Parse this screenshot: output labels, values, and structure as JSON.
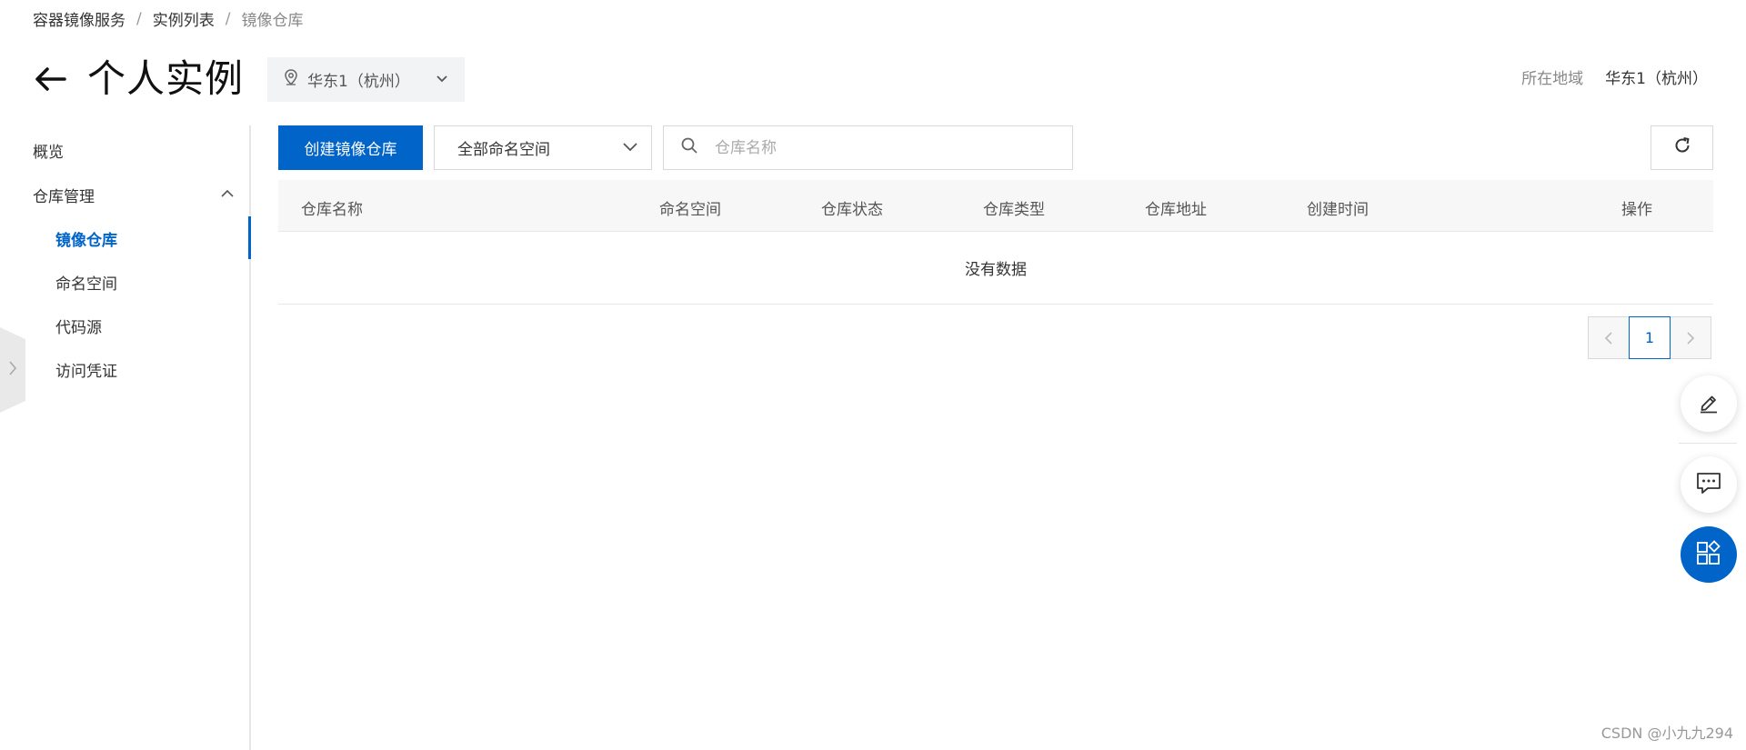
{
  "breadcrumb": {
    "items": [
      "容器镜像服务",
      "实例列表",
      "镜像仓库"
    ],
    "separator": "/"
  },
  "header": {
    "title": "个人实例",
    "region_select": "华东1（杭州）",
    "region_label": "所在地域",
    "region_value": "华东1（杭州）"
  },
  "sidebar": {
    "overview": "概览",
    "group": "仓库管理",
    "items": [
      "镜像仓库",
      "命名空间",
      "代码源",
      "访问凭证"
    ]
  },
  "toolbar": {
    "create_button": "创建镜像仓库",
    "namespace_select": "全部命名空间",
    "search_placeholder": "仓库名称"
  },
  "table": {
    "columns": [
      "仓库名称",
      "命名空间",
      "仓库状态",
      "仓库类型",
      "仓库地址",
      "创建时间",
      "操作"
    ],
    "empty_text": "没有数据"
  },
  "pagination": {
    "current_page": "1"
  },
  "watermark": "CSDN @小九九294",
  "colors": {
    "primary": "#0064c8"
  }
}
